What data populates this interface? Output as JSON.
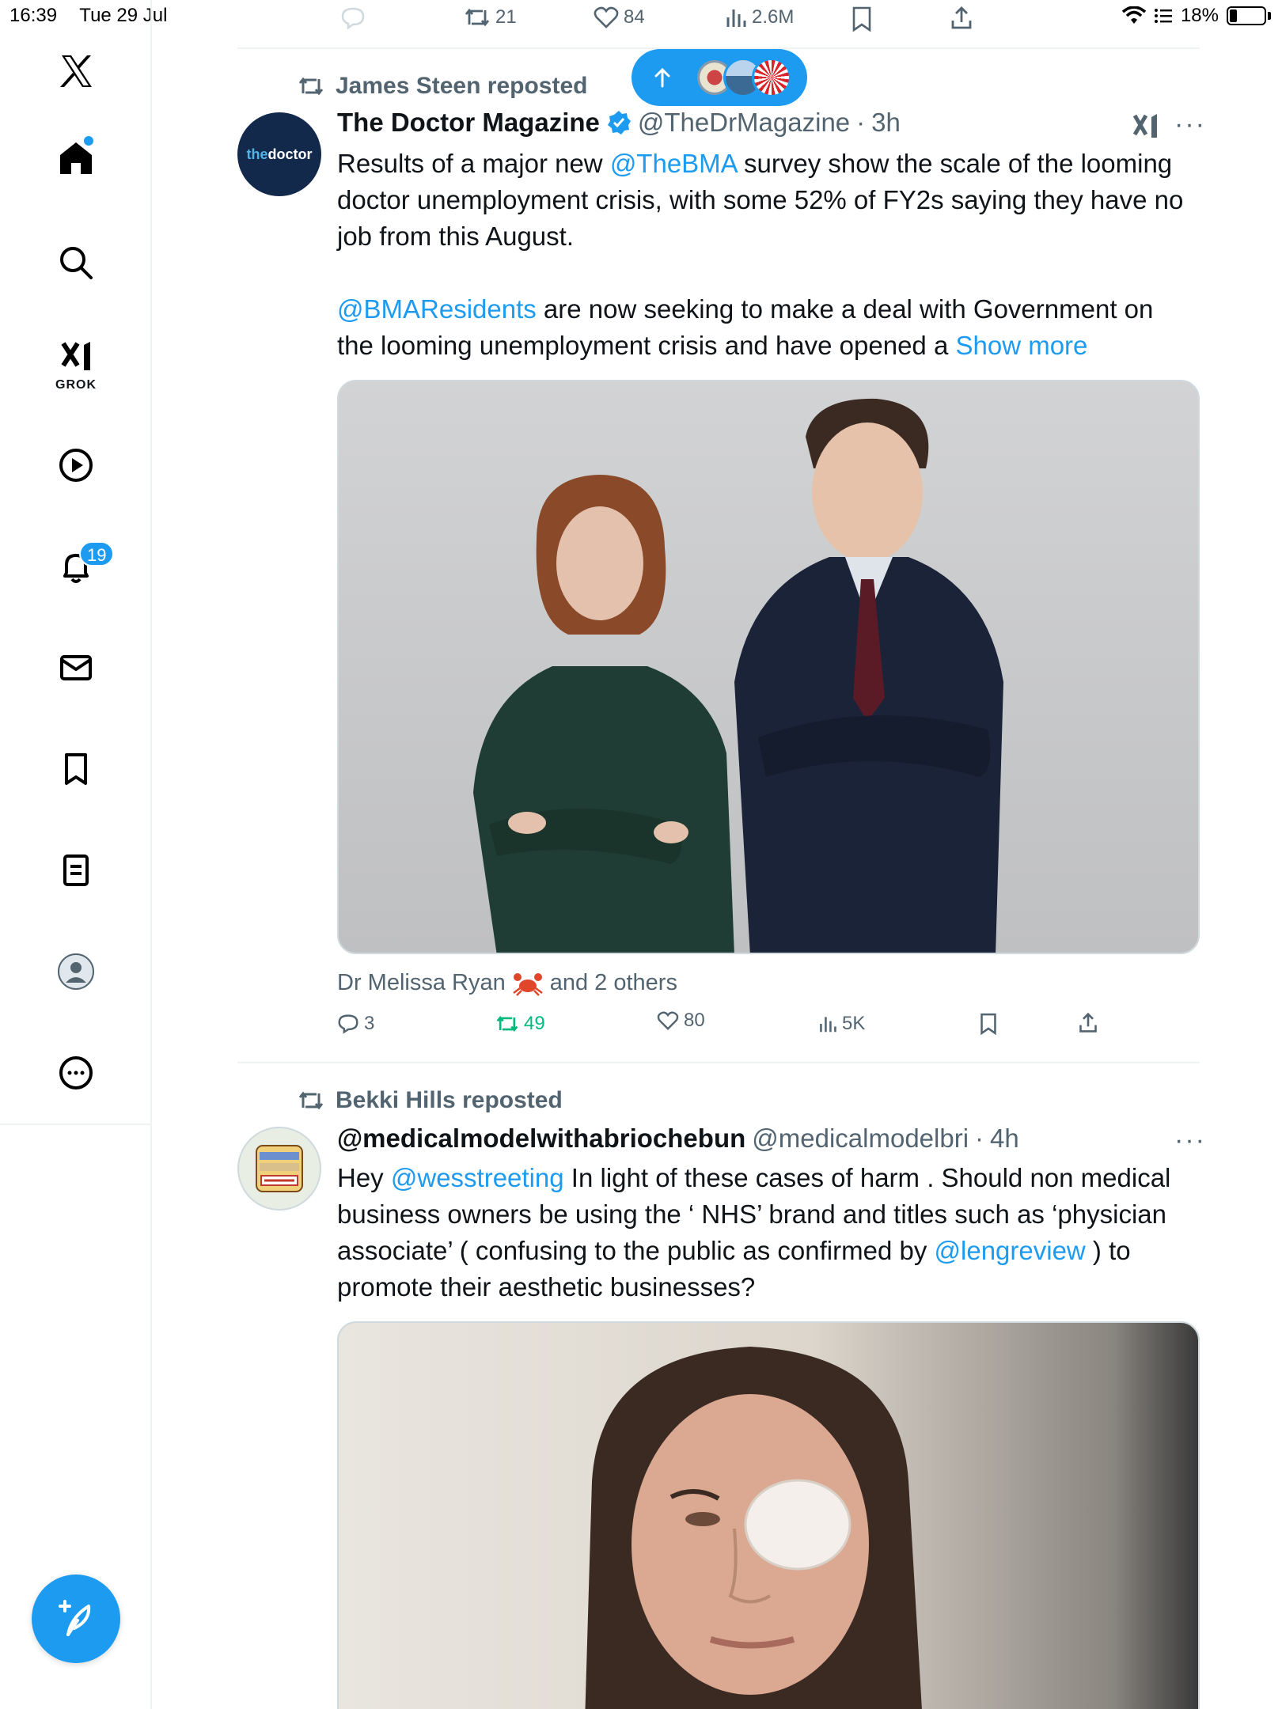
{
  "status_bar": {
    "time": "16:39",
    "date": "Tue 29 Jul",
    "battery": "18%"
  },
  "sidebar": {
    "grok_label": "GROK",
    "notifications_badge": "19"
  },
  "top_post_actions": {
    "reposts": "21",
    "likes": "84",
    "views": "2.6M"
  },
  "tweet1": {
    "reposted_by": "James Steen reposted",
    "avatar_text_a": "the",
    "avatar_text_b": "doctor",
    "name": "The Doctor Magazine",
    "handle": "@TheDrMagazine",
    "sep": "·",
    "time": "3h",
    "text": {
      "p1_a": "Results of a major new ",
      "p1_link": "@TheBMA",
      "p1_b": " survey show the scale of the looming doctor unemployment crisis, with some 52% of FY2s saying they have no job from this August.",
      "p2_link": "@BMAResidents",
      "p2_b": " are now seeking to make a deal with Government on the looming unemployment crisis and have opened a ",
      "show_more": "Show more"
    },
    "liked_by_name": "Dr Melissa Ryan",
    "liked_by_rest": "and 2 others",
    "actions": {
      "replies": "3",
      "reposts": "49",
      "likes": "80",
      "views": "5K"
    }
  },
  "tweet2": {
    "reposted_by": "Bekki Hills reposted",
    "name": "@medicalmodelwithabriochebun",
    "handle": "@medicalmodelbri",
    "sep": "·",
    "time": "4h",
    "text": {
      "a": "Hey ",
      "link1": "@wesstreeting",
      "b": "  In light of these cases of harm . Should non medical business owners be using the ‘ NHS’ brand and titles such as ‘physician associate’  ( confusing to the public as confirmed by ",
      "link2": "@lengreview",
      "c": " ) to promote their aesthetic businesses?"
    }
  },
  "colors": {
    "accent": "#1d9bf0",
    "repost_green": "#00ba7c",
    "muted": "#536471",
    "doctor_navy": "#13294b"
  },
  "icons": [
    "x-logo-icon",
    "home-icon",
    "search-icon",
    "grok-icon",
    "video-icon",
    "bell-icon",
    "mail-icon",
    "bookmark-icon",
    "list-icon",
    "profile-icon",
    "more-icon",
    "compose-icon",
    "reply-icon",
    "repost-icon",
    "like-icon",
    "views-icon",
    "share-icon",
    "verified-icon",
    "crab-icon"
  ]
}
